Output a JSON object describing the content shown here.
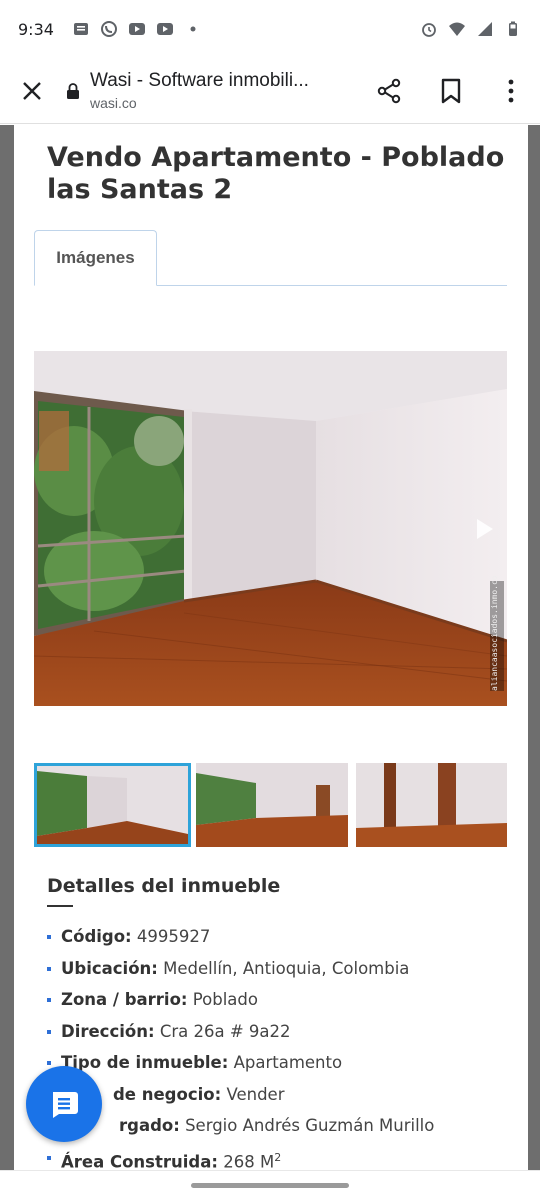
{
  "status_bar": {
    "time": "9:34",
    "left_icons": [
      "news-icon",
      "whatsapp-icon",
      "youtube-icon",
      "youtube-icon",
      "dot-icon"
    ],
    "right_icons": [
      "alarm-icon",
      "wifi-icon",
      "signal-icon",
      "battery-icon"
    ]
  },
  "toolbar": {
    "title": "Wasi - Software inmobili...",
    "url": "wasi.co"
  },
  "property": {
    "title": "Vendo Apartamento - Poblado las Santas 2"
  },
  "tabs": [
    {
      "label": "Imágenes",
      "active": true
    }
  ],
  "gallery": {
    "watermark": "aliancaasociados.inmo.co",
    "thumbnails_visible": 3,
    "selected_index": 0
  },
  "details": {
    "heading": "Detalles del inmueble",
    "items": [
      {
        "label": "Código:",
        "value": "4995927"
      },
      {
        "label": "Ubicación:",
        "value": "Medellín, Antioquia, Colombia"
      },
      {
        "label": "Zona / barrio:",
        "value": "Poblado"
      },
      {
        "label": "Dirección:",
        "value": "Cra 26a # 9a22"
      },
      {
        "label": "Tipo de inmueble:",
        "value": "Apartamento"
      },
      {
        "label": "de negocio:",
        "value": "Vender"
      },
      {
        "label": "rgado:",
        "value": "Sergio Andrés Guzmán Murillo"
      },
      {
        "label": "Área Construida:",
        "value": "268 M",
        "sup": "2"
      }
    ]
  },
  "colors": {
    "accent": "#1a73e8",
    "tab_border": "#bfd4ea",
    "thumb_selected": "#2ea3d9"
  }
}
